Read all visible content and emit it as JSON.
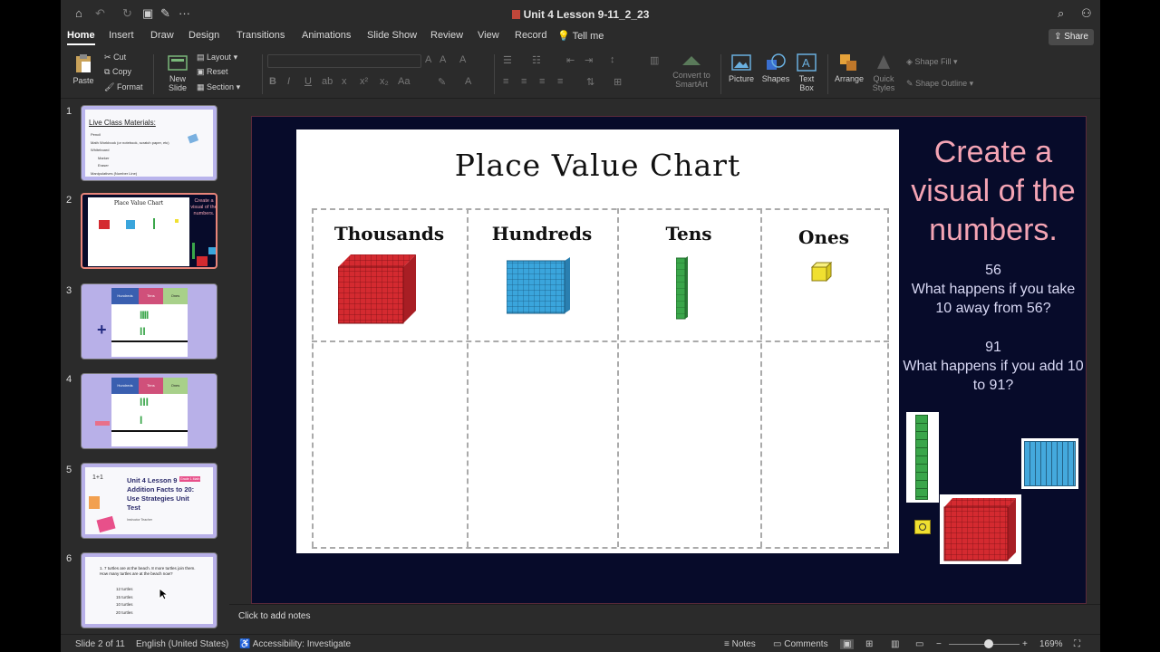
{
  "window": {
    "title": "Unit 4 Lesson 9-11_2_23"
  },
  "tabs": [
    "Home",
    "Insert",
    "Draw",
    "Design",
    "Transitions",
    "Animations",
    "Slide Show",
    "Review",
    "View",
    "Record"
  ],
  "tell_me": "Tell me",
  "share": "Share",
  "ribbon": {
    "paste": "Paste",
    "cut": "Cut",
    "copy": "Copy",
    "format": "Format",
    "new_slide": "New Slide",
    "layout": "Layout",
    "reset": "Reset",
    "section": "Section",
    "convert_smartart": "Convert to SmartArt",
    "picture": "Picture",
    "shapes": "Shapes",
    "text_box": "Text Box",
    "arrange": "Arrange",
    "quick_styles": "Quick Styles",
    "shape_fill": "Shape Fill",
    "shape_outline": "Shape Outline"
  },
  "thumbnails": [
    {
      "num": "1",
      "title": "Live Class Materials:",
      "lines": [
        "Pencil",
        "Math Workbook (or notebook, scratch paper, etc)",
        "Whiteboard",
        "Marker",
        "Eraser",
        "Manipulatives (Number Line)"
      ]
    },
    {
      "num": "2",
      "title": "Place Value Chart",
      "side": "Create a visual of the numbers."
    },
    {
      "num": "3",
      "heads": [
        "Hundreds",
        "Tens",
        "Ones"
      ]
    },
    {
      "num": "4",
      "heads": [
        "Hundreds",
        "Tens",
        "Ones"
      ]
    },
    {
      "num": "5",
      "title": "Unit 4 Lesson 9 Addition Facts to 20: Use Strategies Unit Test",
      "badge": "Grade 1 Math",
      "teacher": "Instructor Teacher",
      "corner": "1+1"
    },
    {
      "num": "6",
      "question": "1. 7 turtles are at the beach. 8 more turtles join them. How many turtles are at the beach now?",
      "options": [
        "12 turtles",
        "15 turtles",
        "10 turtles",
        "20 turtles"
      ]
    }
  ],
  "slide": {
    "chart_title": "Place Value Chart",
    "columns": [
      "Thousands",
      "Hundreds",
      "Tens",
      "Ones"
    ],
    "side_title": "Create a visual of the numbers.",
    "q1_number": "56",
    "q1_text": "What happens if you take 10 away from 56?",
    "q2_number": "91",
    "q2_text": "What happens if you add 10 to 91?"
  },
  "notes": "Click to add notes",
  "status": {
    "slide": "Slide 2 of 11",
    "language": "English (United States)",
    "accessibility": "Accessibility: Investigate",
    "notes_btn": "Notes",
    "comments_btn": "Comments",
    "zoom": "169%"
  },
  "colors": {
    "thousands": "#d42a30",
    "hundreds": "#3aa5dc",
    "tens": "#3aa64a",
    "ones": "#f0e030",
    "slide_bg": "#070b2a",
    "side_title": "#f4a4b4"
  }
}
